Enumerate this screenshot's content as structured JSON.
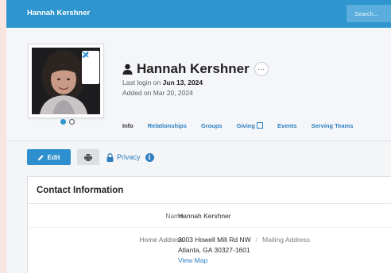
{
  "topbar": {
    "title": "Hannah Kershner",
    "search_placeholder": "Search..."
  },
  "profile": {
    "name": "Hannah Kershner",
    "more_label": "···",
    "last_login_prefix": "Last login on ",
    "last_login_date": "Jun 13, 2024",
    "added": "Added on Mar 20, 2024",
    "photo_actions": [
      "pencil-icon",
      "close-icon"
    ],
    "carousel_active_index": 0,
    "carousel_count": 2
  },
  "tabs": [
    {
      "label": "Info",
      "active": true
    },
    {
      "label": "Relationships",
      "active": false
    },
    {
      "label": "Groups",
      "active": false
    },
    {
      "label": "Giving",
      "active": false,
      "external": true
    },
    {
      "label": "Events",
      "active": false
    },
    {
      "label": "Serving Teams",
      "active": false
    }
  ],
  "toolbar": {
    "edit_label": "Edit",
    "privacy_label": "Privacy",
    "info_icon": "i"
  },
  "contact": {
    "title": "Contact Information",
    "name_label": "Name",
    "name_value": "Hannah Kershner",
    "home_address_label": "Home Address",
    "address_line1": "3003 Howell Mill Rd NW",
    "separator": "/",
    "mailing_address_label": "Mailing Address",
    "address_line2": "Atlanta, GA 30327-1601",
    "view_map_label": "View Map"
  },
  "colors": {
    "brand_blue": "#2e95cf",
    "link_blue": "#2e7fc0",
    "page_bg": "#f4f5f7",
    "outer_bg": "#f7e6e0"
  }
}
